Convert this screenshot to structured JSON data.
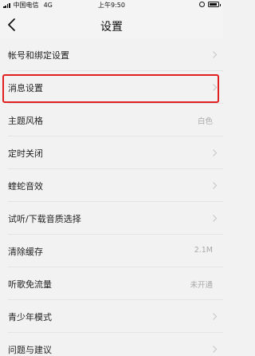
{
  "status_bar": {
    "carrier": "中国电信",
    "network": "4G",
    "time": "上午9:50",
    "battery_level": 0.85
  },
  "nav": {
    "title": "设置",
    "back_icon": "chevron-left-icon"
  },
  "settings": {
    "items": [
      {
        "label": "帐号和绑定设置",
        "value": ""
      },
      {
        "label": "消息设置",
        "value": "",
        "highlighted": true
      },
      {
        "label": "主题风格",
        "value": "白色"
      },
      {
        "label": "定时关闭",
        "value": ""
      },
      {
        "label": "蝰蛇音效",
        "value": ""
      },
      {
        "label": "试听/下载音质选择",
        "value": ""
      },
      {
        "label": "清除缓存",
        "value": "2.1M"
      },
      {
        "label": "听歌免流量",
        "value": "未开通"
      },
      {
        "label": "青少年模式",
        "value": ""
      },
      {
        "label": "问题与建议",
        "value": ""
      }
    ]
  },
  "colors": {
    "highlight": "#e02020",
    "background": "#f2f2f2",
    "secondary_text": "#a8a8a8"
  }
}
